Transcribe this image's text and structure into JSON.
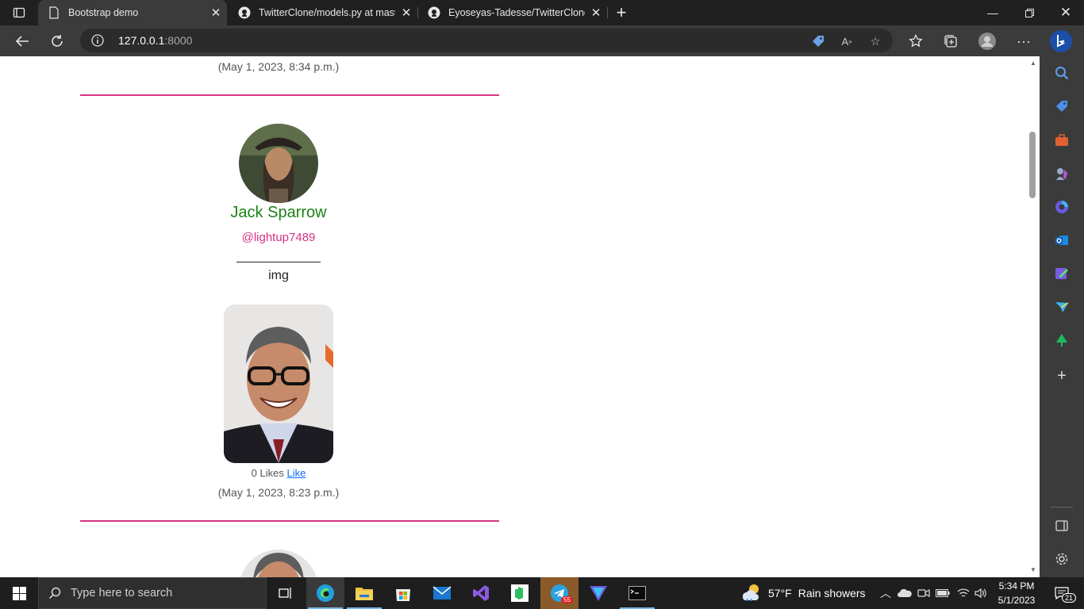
{
  "browser": {
    "tabs": [
      {
        "title": "Bootstrap demo",
        "active": true
      },
      {
        "title": "TwitterClone/models.py at maste",
        "active": false
      },
      {
        "title": "Eyoseyas-Tadesse/TwitterClone: S",
        "active": false
      }
    ],
    "address": {
      "host": "127.0.0.1",
      "port": ":8000"
    }
  },
  "page": {
    "top_post_date": "(May 1, 2023, 8:34 p.m.)",
    "post": {
      "author_name": "Jack Sparrow",
      "author_handle": "@lightup7489",
      "separator": "_____________",
      "text": "img",
      "likes_count": "0 Likes",
      "like_link": "Like",
      "date": "(May 1, 2023, 8:23 p.m.)"
    }
  },
  "taskbar": {
    "search_placeholder": "Type here to search",
    "weather_temp": "57°F",
    "weather_desc": "Rain showers",
    "time": "5:34 PM",
    "date": "5/1/2023",
    "notification_count": "21",
    "telegram_badge": "55"
  },
  "colors": {
    "accent_pink": "#d63384",
    "name_green": "#198214",
    "link_blue": "#0d6efd"
  }
}
